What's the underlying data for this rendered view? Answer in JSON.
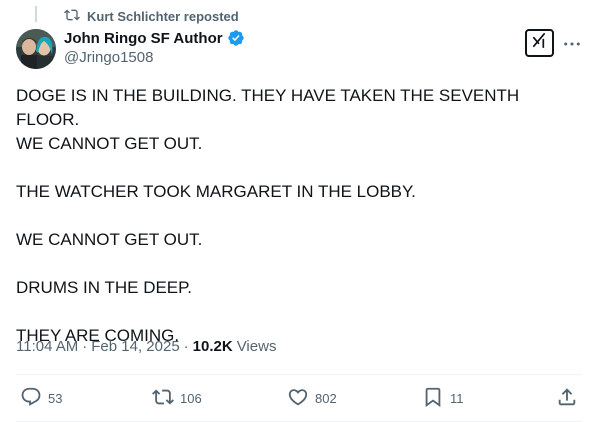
{
  "repost": {
    "label": "Kurt Schlichter reposted"
  },
  "author": {
    "display_name": "John Ringo SF Author",
    "handle": "@Jringo1508",
    "verified": true
  },
  "tweet": {
    "lines": [
      "DOGE IS IN THE BUILDING. THEY HAVE TAKEN THE SEVENTH FLOOR.",
      "WE CANNOT GET OUT.",
      "THE WATCHER TOOK MARGARET IN THE LOBBY.",
      "WE CANNOT GET OUT.",
      "DRUMS IN THE DEEP.",
      "THEY ARE COMING."
    ]
  },
  "meta": {
    "time": "11:04 AM",
    "date": "Feb 14, 2025",
    "views_count": "10.2K",
    "views_label": "Views"
  },
  "actions": {
    "replies": "53",
    "reposts": "106",
    "likes": "802",
    "bookmarks": "11"
  },
  "colors": {
    "text": "#0f1419",
    "secondary": "#536471",
    "verified": "#1d9bf0",
    "border": "#eff3f4"
  }
}
